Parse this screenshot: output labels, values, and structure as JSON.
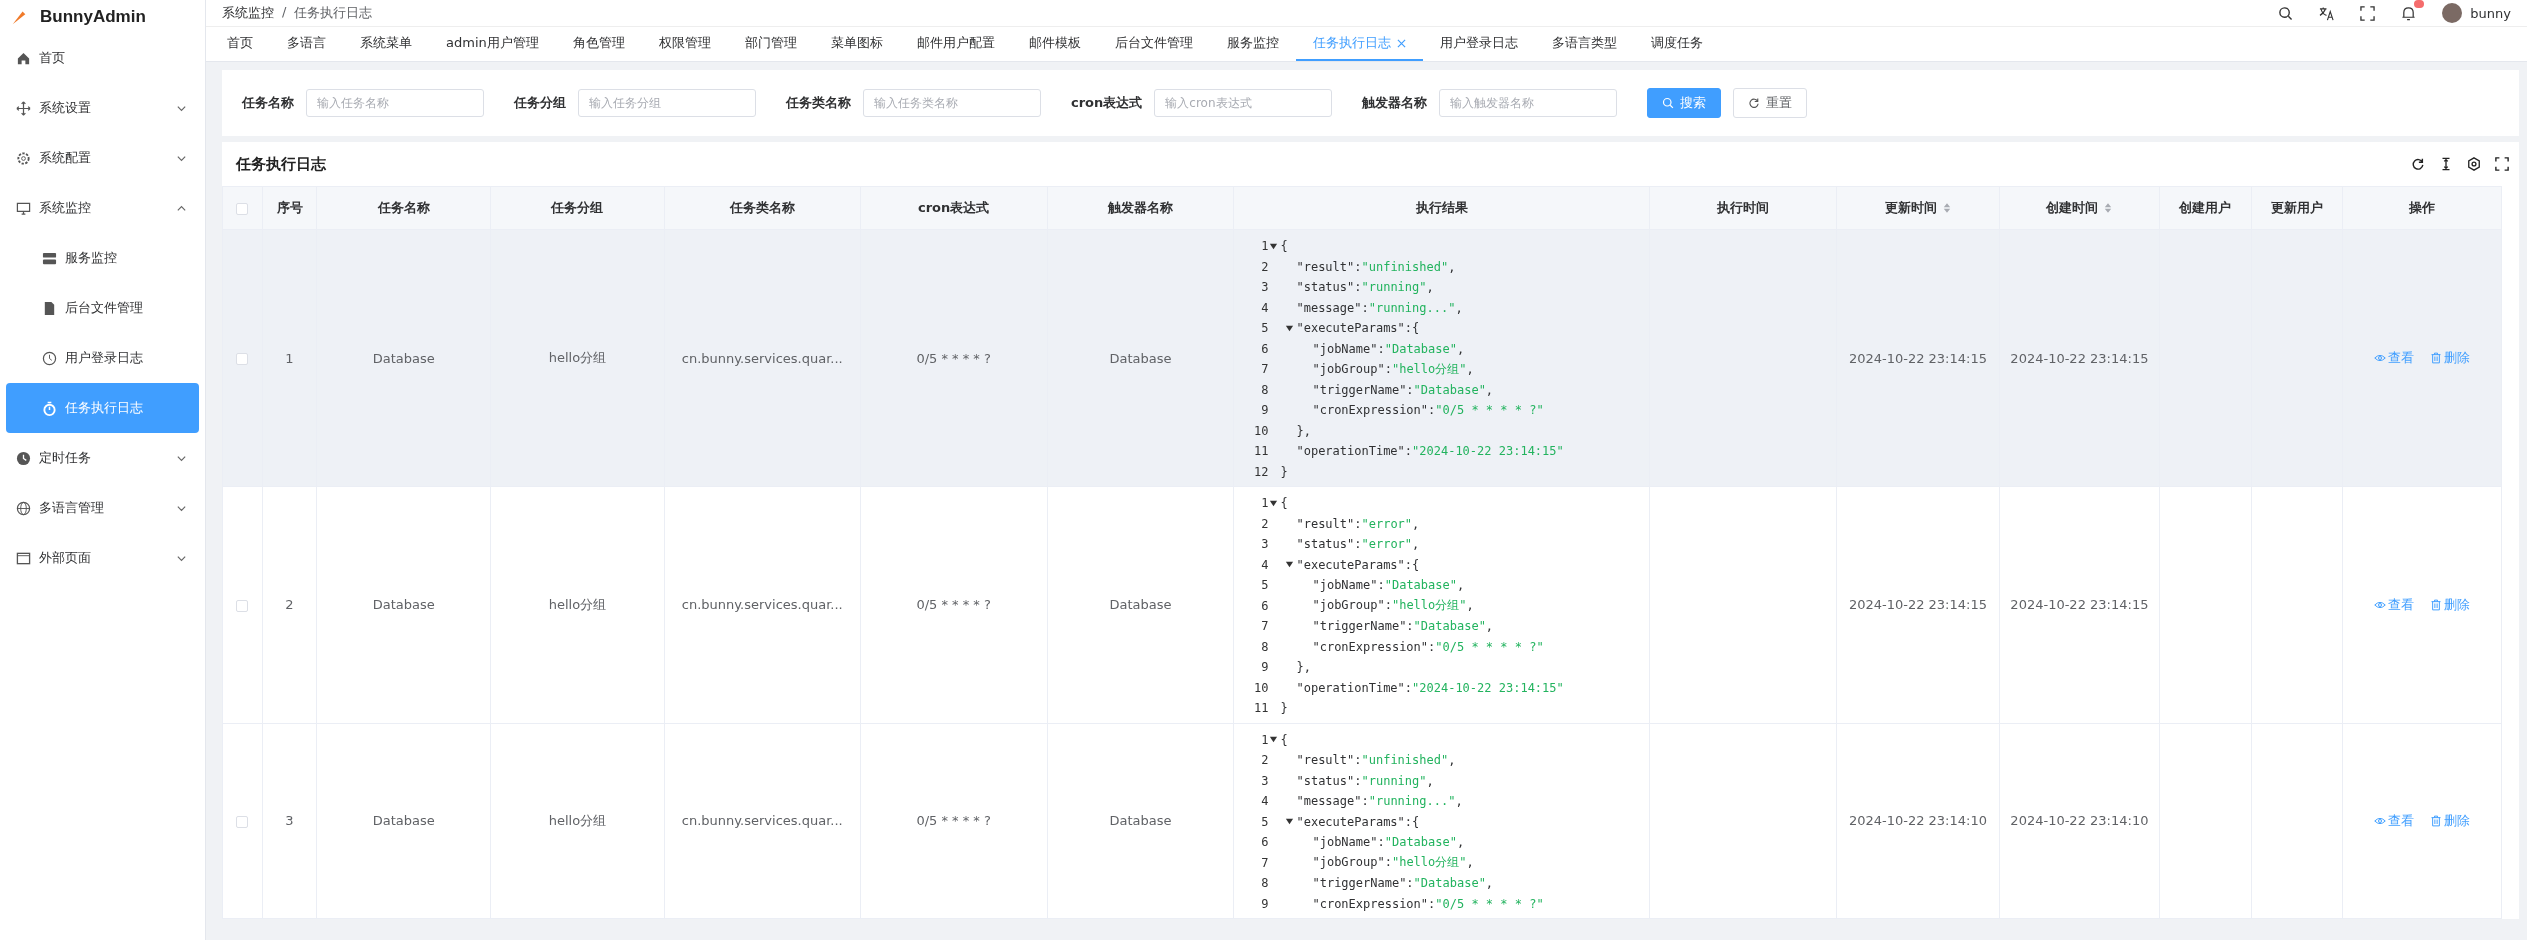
{
  "sidebar": {
    "logo": "BunnyAdmin",
    "items": [
      {
        "label": "首页",
        "selected": false
      },
      {
        "label": "系统设置",
        "selected": false,
        "expanded": false
      },
      {
        "label": "系统配置",
        "selected": false,
        "expanded": false
      },
      {
        "label": "系统监控",
        "selected": false,
        "expanded": true,
        "children": [
          {
            "label": "服务监控",
            "selected": false
          },
          {
            "label": "后台文件管理",
            "selected": false
          },
          {
            "label": "用户登录日志",
            "selected": false
          },
          {
            "label": "任务执行日志",
            "selected": true
          }
        ]
      },
      {
        "label": "定时任务",
        "selected": false,
        "expanded": false
      },
      {
        "label": "多语言管理",
        "selected": false,
        "expanded": false
      },
      {
        "label": "外部页面",
        "selected": false,
        "expanded": false
      }
    ]
  },
  "header": {
    "breadcrumb": [
      "系统监控",
      "任务执行日志"
    ],
    "breadcrumb_separator": "/",
    "user": "bunny"
  },
  "tabs": [
    {
      "label": "首页",
      "selected": false
    },
    {
      "label": "多语言",
      "selected": false
    },
    {
      "label": "系统菜单",
      "selected": false
    },
    {
      "label": "admin用户管理",
      "selected": false
    },
    {
      "label": "角色管理",
      "selected": false
    },
    {
      "label": "权限管理",
      "selected": false
    },
    {
      "label": "部门管理",
      "selected": false
    },
    {
      "label": "菜单图标",
      "selected": false
    },
    {
      "label": "邮件用户配置",
      "selected": false
    },
    {
      "label": "邮件模板",
      "selected": false
    },
    {
      "label": "后台文件管理",
      "selected": false
    },
    {
      "label": "服务监控",
      "selected": false
    },
    {
      "label": "任务执行日志",
      "selected": true
    },
    {
      "label": "用户登录日志",
      "selected": false
    },
    {
      "label": "多语言类型",
      "selected": false
    },
    {
      "label": "调度任务",
      "selected": false
    }
  ],
  "search": {
    "fields": [
      {
        "label": "任务名称",
        "placeholder": "输入任务名称"
      },
      {
        "label": "任务分组",
        "placeholder": "输入任务分组"
      },
      {
        "label": "任务类名称",
        "placeholder": "输入任务类名称"
      },
      {
        "label": "cron表达式",
        "placeholder": "输入cron表达式"
      },
      {
        "label": "触发器名称",
        "placeholder": "输入触发器名称"
      }
    ],
    "buttons": [
      {
        "label": "搜索",
        "kind": "search"
      },
      {
        "label": "重置",
        "kind": "reset"
      }
    ]
  },
  "table": {
    "title": "任务执行日志",
    "header_checked": false,
    "columns": [
      {
        "label": "序号",
        "sortable": false
      },
      {
        "label": "任务名称",
        "sortable": false
      },
      {
        "label": "任务分组",
        "sortable": false
      },
      {
        "label": "任务类名称",
        "sortable": false
      },
      {
        "label": "cron表达式",
        "sortable": false
      },
      {
        "label": "触发器名称",
        "sortable": false
      },
      {
        "label": "执行结果",
        "sortable": false
      },
      {
        "label": "执行时间",
        "sortable": false
      },
      {
        "label": "更新时间",
        "sortable": true
      },
      {
        "label": "创建时间",
        "sortable": true
      },
      {
        "label": "创建用户",
        "sortable": false
      },
      {
        "label": "更新用户",
        "sortable": false
      },
      {
        "label": "操作",
        "sortable": false
      }
    ],
    "rows": [
      {
        "checked": false,
        "highlighted": true,
        "index": "1",
        "job_name": "Database",
        "job_group": "hello分组",
        "job_class": "cn.bunny.services.quar...",
        "cron": "0/5 * * * * ?",
        "trigger_name": "Database",
        "updated": "2024-10-22 23:14:15",
        "created": "2024-10-22 23:14:15",
        "actions": [
          {
            "label": "查看",
            "kind": "view"
          },
          {
            "label": "删除",
            "kind": "delete"
          }
        ],
        "result": [
          {
            "no": "1",
            "punct": "{",
            "expanded": true,
            "children": [
              {
                "no": "2",
                "key": "\"result\":",
                "value": "\"unfinished\"",
                "punct": ","
              },
              {
                "no": "3",
                "key": "\"status\":",
                "value": "\"running\"",
                "punct": ","
              },
              {
                "no": "4",
                "key": "\"message\":",
                "value": "\"running...\"",
                "punct": ","
              },
              {
                "no": "5",
                "key": "\"executeParams\":",
                "punct": "{",
                "expanded": true,
                "children": [
                  {
                    "no": "6",
                    "key": "\"jobName\":",
                    "value": "\"Database\"",
                    "punct": ","
                  },
                  {
                    "no": "7",
                    "key": "\"jobGroup\":",
                    "value": "\"hello分组\"",
                    "punct": ","
                  },
                  {
                    "no": "8",
                    "key": "\"triggerName\":",
                    "value": "\"Database\"",
                    "punct": ","
                  },
                  {
                    "no": "9",
                    "key": "\"cronExpression\":",
                    "value": "\"0/5 * * * * ?\""
                  }
                ]
              },
              {
                "no": "10",
                "punct": "},"
              },
              {
                "no": "11",
                "key": "\"operationTime\":",
                "value": "\"2024-10-22 23:14:15\""
              }
            ]
          },
          {
            "no": "12",
            "punct": "}"
          }
        ]
      },
      {
        "checked": false,
        "highlighted": false,
        "index": "2",
        "job_name": "Database",
        "job_group": "hello分组",
        "job_class": "cn.bunny.services.quar...",
        "cron": "0/5 * * * * ?",
        "trigger_name": "Database",
        "updated": "2024-10-22 23:14:15",
        "created": "2024-10-22 23:14:15",
        "actions": [
          {
            "label": "查看",
            "kind": "view"
          },
          {
            "label": "删除",
            "kind": "delete"
          }
        ],
        "result": [
          {
            "no": "1",
            "punct": "{",
            "expanded": true,
            "children": [
              {
                "no": "2",
                "key": "\"result\":",
                "value": "\"error\"",
                "punct": ","
              },
              {
                "no": "3",
                "key": "\"status\":",
                "value": "\"error\"",
                "punct": ","
              },
              {
                "no": "4",
                "key": "\"executeParams\":",
                "punct": "{",
                "expanded": true,
                "children": [
                  {
                    "no": "5",
                    "key": "\"jobName\":",
                    "value": "\"Database\"",
                    "punct": ","
                  },
                  {
                    "no": "6",
                    "key": "\"jobGroup\":",
                    "value": "\"hello分组\"",
                    "punct": ","
                  },
                  {
                    "no": "7",
                    "key": "\"triggerName\":",
                    "value": "\"Database\"",
                    "punct": ","
                  },
                  {
                    "no": "8",
                    "key": "\"cronExpression\":",
                    "value": "\"0/5 * * * * ?\""
                  }
                ]
              },
              {
                "no": "9",
                "punct": "},"
              },
              {
                "no": "10",
                "key": "\"operationTime\":",
                "value": "\"2024-10-22 23:14:15\""
              }
            ]
          },
          {
            "no": "11",
            "punct": "}"
          }
        ]
      },
      {
        "checked": false,
        "highlighted": false,
        "index": "3",
        "job_name": "Database",
        "job_group": "hello分组",
        "job_class": "cn.bunny.services.quar...",
        "cron": "0/5 * * * * ?",
        "trigger_name": "Database",
        "updated": "2024-10-22 23:14:10",
        "created": "2024-10-22 23:14:10",
        "actions": [
          {
            "label": "查看",
            "kind": "view"
          },
          {
            "label": "删除",
            "kind": "delete"
          }
        ],
        "result": [
          {
            "no": "1",
            "punct": "{",
            "expanded": true,
            "children": [
              {
                "no": "2",
                "key": "\"result\":",
                "value": "\"unfinished\"",
                "punct": ","
              },
              {
                "no": "3",
                "key": "\"status\":",
                "value": "\"running\"",
                "punct": ","
              },
              {
                "no": "4",
                "key": "\"message\":",
                "value": "\"running...\"",
                "punct": ","
              },
              {
                "no": "5",
                "key": "\"executeParams\":",
                "punct": "{",
                "expanded": true,
                "children": [
                  {
                    "no": "6",
                    "key": "\"jobName\":",
                    "value": "\"Database\"",
                    "punct": ","
                  },
                  {
                    "no": "7",
                    "key": "\"jobGroup\":",
                    "value": "\"hello分组\"",
                    "punct": ","
                  },
                  {
                    "no": "8",
                    "key": "\"triggerName\":",
                    "value": "\"Database\"",
                    "punct": ","
                  },
                  {
                    "no": "9",
                    "key": "\"cronExpression\":",
                    "value": "\"0/5 * * * * ?\""
                  }
                ]
              }
            ]
          }
        ]
      }
    ]
  }
}
